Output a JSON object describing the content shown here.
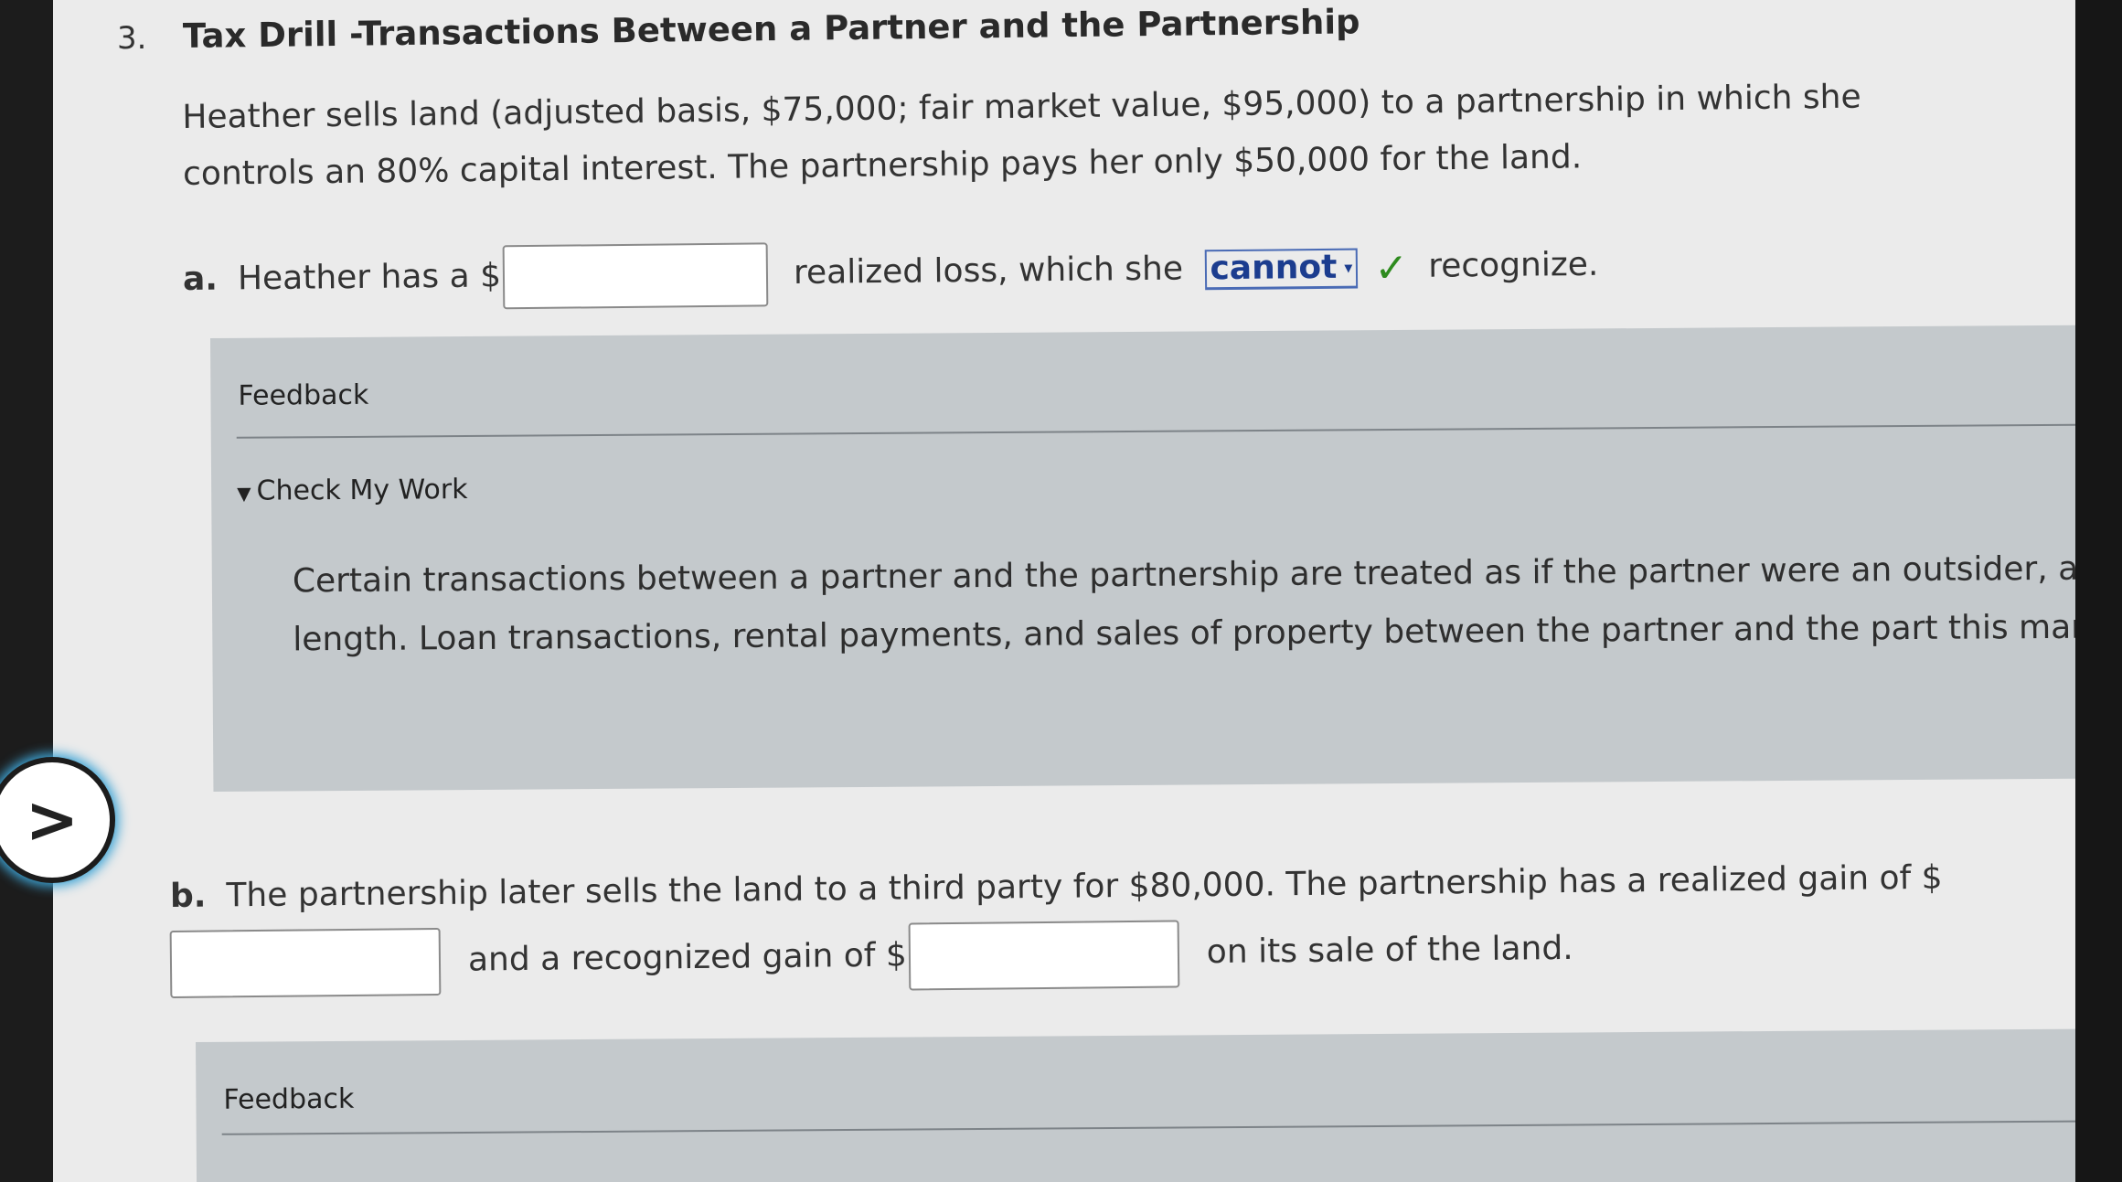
{
  "question": {
    "number": "3.",
    "title": "Tax Drill -Transactions Between a Partner and the Partnership",
    "intro": "Heather sells land (adjusted basis, $75,000; fair market value, $95,000) to a partnership in which she controls an 80% capital interest. The partnership pays her only $50,000 for the land."
  },
  "part_a": {
    "label": "a.",
    "text_before": "Heather has a $",
    "input_value": "",
    "text_middle": "realized loss, which she",
    "dropdown_value": "cannot",
    "status_icon": "check-icon",
    "text_after": "recognize."
  },
  "feedback_a": {
    "title": "Feedback",
    "toggle": "Check My Work",
    "text": "Certain transactions between a partner and the partnership are treated as if the partner were an outsider, arm's length. Loan transactions, rental payments, and sales of property between the partner and the part this manner."
  },
  "part_b": {
    "label": "b.",
    "text1": "The partnership later sells the land to a third party for $80,000. The partnership has a realized gain of $",
    "input1_value": "",
    "text2": "and a recognized gain of $",
    "input2_value": "",
    "text3": "on its sale of the land."
  },
  "feedback_b": {
    "title": "Feedback"
  },
  "nav": {
    "next_symbol": ">"
  },
  "colors": {
    "accent": "#1c3d8f",
    "check": "#2e8b1e",
    "feedback_bg": "#c4c9cc",
    "nav_glow": "#3fa5d6"
  }
}
